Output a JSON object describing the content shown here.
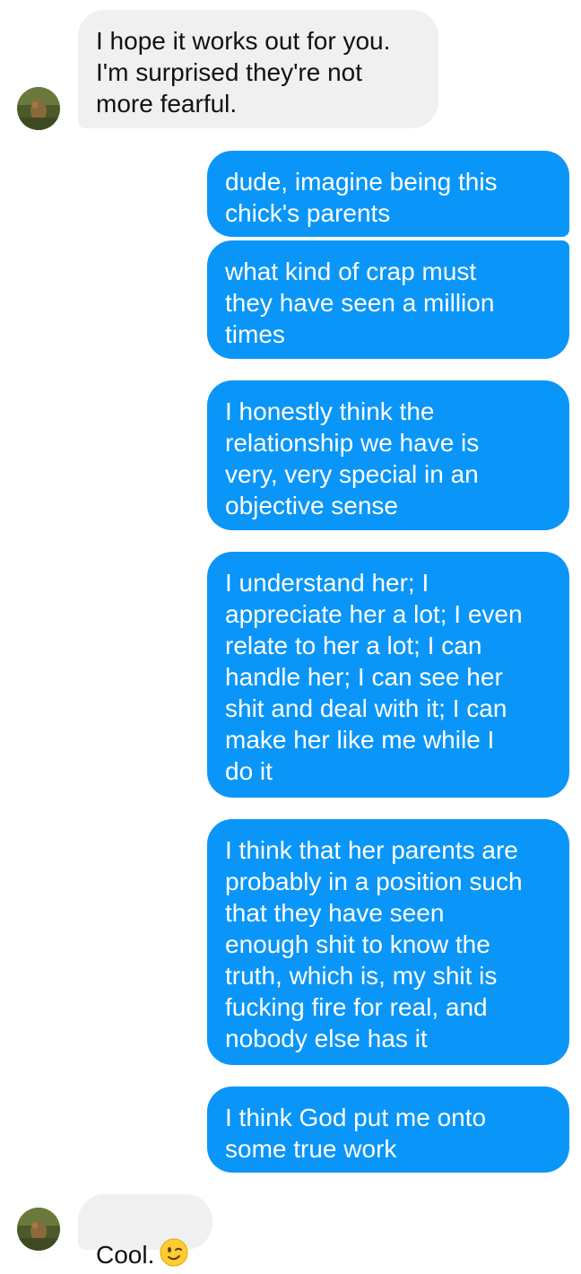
{
  "thread": {
    "incoming": [
      {
        "text": "I hope it works out for you.\nI'm surprised they're not\nmore fearful."
      },
      {
        "text": "Cool."
      }
    ],
    "outgoing": [
      {
        "text": "dude, imagine being this\nchick's parents"
      },
      {
        "text": "what kind of crap must\nthey have seen a million\ntimes"
      },
      {
        "text": "I honestly think the\nrelationship we have is\nvery, very special in an\nobjective sense"
      },
      {
        "text": "I understand her; I\nappreciate her a lot; I even\nrelate to her a lot; I can\nhandle her; I can see her\nshit and deal with it; I can\nmake her like me while I\ndo it"
      },
      {
        "text": "I think that her parents are\nprobably in a position such\nthat they have seen\nenough shit to know the\ntruth, which is, my shit is\nfucking fire for real, and\nnobody else has it"
      },
      {
        "text": "I think God put me onto\nsome true work"
      }
    ]
  },
  "icons": {
    "avatar": "contact-avatar",
    "emoji": "winking-face-emoji"
  },
  "colors": {
    "outgoing_bubble": "#0a96f8",
    "incoming_bubble": "#f0f0f0"
  }
}
